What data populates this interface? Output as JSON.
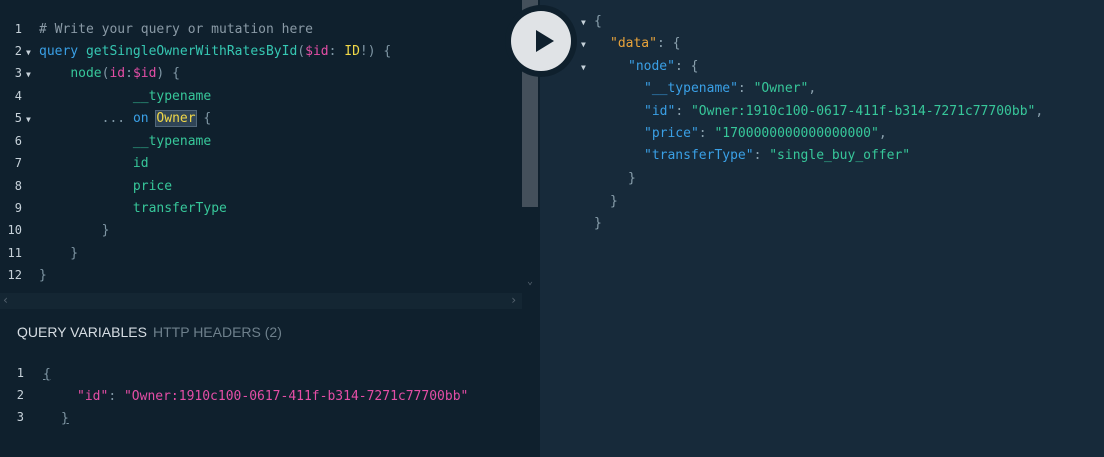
{
  "query_editor": {
    "line_numbers": [
      "1",
      "2",
      "3",
      "4",
      "5",
      "6",
      "7",
      "8",
      "9",
      "10",
      "11",
      "12"
    ],
    "comment": "# Write your query or mutation here",
    "kw_query": "query",
    "op_name": "getSingleOwnerWithRatesById",
    "var_id": "$id",
    "type_id": "ID",
    "field_node": "node",
    "arg_id": "id",
    "arg_var": "$id",
    "typename": "__typename",
    "spread": "...",
    "kw_on": "on",
    "type_owner": "Owner",
    "field_id": "id",
    "field_price": "price",
    "field_transfer": "transferType"
  },
  "variables_panel": {
    "tab_query_variables": "QUERY VARIABLES",
    "tab_http_headers": "HTTP HEADERS (2)",
    "line_numbers": [
      "1",
      "2",
      "3"
    ],
    "key_id": "\"id\"",
    "value_id": "\"Owner:1910c100-0617-411f-b314-7271c77700bb\""
  },
  "result": {
    "key_data": "\"data\"",
    "key_node": "\"node\"",
    "key_typename": "\"__typename\"",
    "val_typename": "\"Owner\"",
    "key_id": "\"id\"",
    "val_id": "\"Owner:1910c100-0617-411f-b314-7271c77700bb\"",
    "key_price": "\"price\"",
    "val_price": "\"1700000000000000000\"",
    "key_transfer": "\"transferType\"",
    "val_transfer": "\"single_buy_offer\""
  },
  "colors": {
    "editor_bg": "#0f202d",
    "result_bg": "#172a3a",
    "keyword": "#3aa0e6",
    "field": "#37c79a",
    "variable": "#e44ea6",
    "type": "#f0d848",
    "top_key": "#e8a33a"
  },
  "icons": {
    "execute": "play-icon"
  }
}
